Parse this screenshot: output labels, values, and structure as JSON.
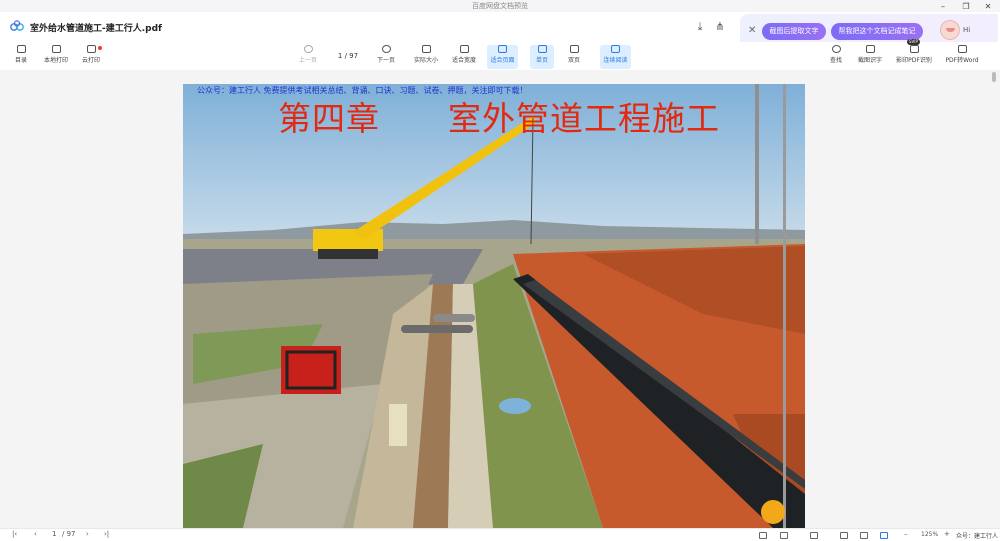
{
  "window": {
    "title": "百度网盘文档预览",
    "controls": [
      "minimize-icon",
      "restore-icon",
      "close-icon"
    ]
  },
  "document": {
    "name": "室外给水管道施工-建工行人.pdf"
  },
  "ai_panel": {
    "btn_extract": "截图后提取文字",
    "btn_notes": "帮我把这个文档记成笔记",
    "greeting": "Hi"
  },
  "toolbar": {
    "left": [
      {
        "label": "目录",
        "icon": "toc-icon"
      },
      {
        "label": "本地打印",
        "icon": "print-icon"
      },
      {
        "label": "云打印",
        "icon": "cloud-print-icon"
      }
    ],
    "prev": "上一页",
    "page_current": "1",
    "page_total": "/ 97",
    "next": "下一页",
    "views": [
      {
        "label": "实际大小",
        "icon": "actual-size-icon"
      },
      {
        "label": "适合宽度",
        "icon": "fit-width-icon"
      },
      {
        "label": "适合页面",
        "icon": "fit-page-icon"
      },
      {
        "label": "单页",
        "icon": "single-page-icon"
      },
      {
        "label": "双页",
        "icon": "double-page-icon"
      },
      {
        "label": "连续阅读",
        "icon": "continuous-icon"
      }
    ],
    "right": [
      {
        "label": "查找",
        "icon": "search-icon"
      },
      {
        "label": "截图识字",
        "icon": "crop-ocr-icon"
      },
      {
        "label": "影印PDF识别",
        "icon": "scan-pdf-icon",
        "badge": "SVIP"
      },
      {
        "label": "PDF转Word",
        "icon": "pdf-to-word-icon"
      }
    ]
  },
  "page_content": {
    "notice": "公众号：建工行人 免费提供考试相关总结、背诵、口诀、习题、试卷、押题，关注即可下载！",
    "heading": "第四章　　室外管道工程施工"
  },
  "statusbar": {
    "page_current": "1",
    "page_total": "/ 97",
    "zoom": "125%",
    "watermark": "众号：建工行人"
  }
}
